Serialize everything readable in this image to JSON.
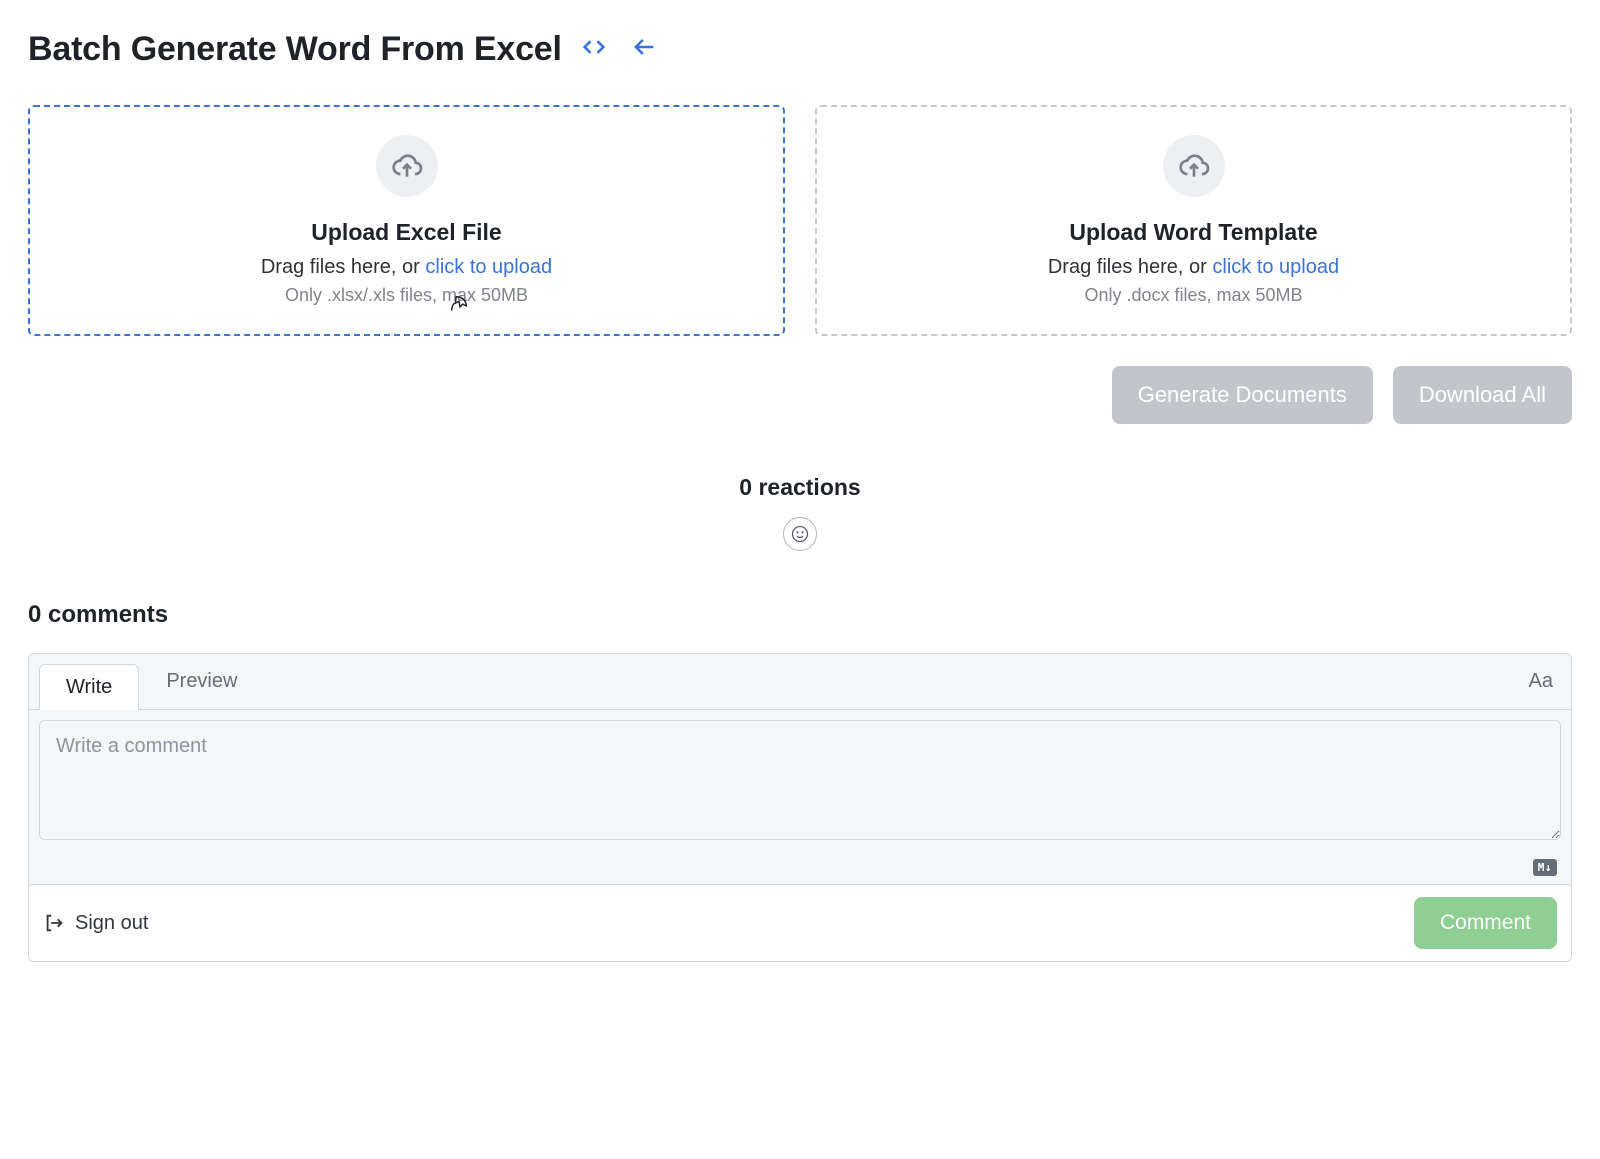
{
  "header": {
    "title": "Batch Generate Word From Excel"
  },
  "uploads": {
    "excel": {
      "title": "Upload Excel File",
      "sub_prefix": "Drag files here, or ",
      "sub_link": "click to upload",
      "note": "Only .xlsx/.xls files, max 50MB"
    },
    "word": {
      "title": "Upload Word Template",
      "sub_prefix": "Drag files here, or ",
      "sub_link": "click to upload",
      "note": "Only .docx files, max 50MB"
    }
  },
  "actions": {
    "generate": "Generate Documents",
    "download": "Download All"
  },
  "reactions": {
    "count_label": "0 reactions"
  },
  "comments": {
    "count_label": "0 comments",
    "tabs": {
      "write": "Write",
      "preview": "Preview"
    },
    "text_size_label": "Aa",
    "placeholder": "Write a comment",
    "markdown_badge": "M↓",
    "signout": "Sign out",
    "submit": "Comment"
  }
}
